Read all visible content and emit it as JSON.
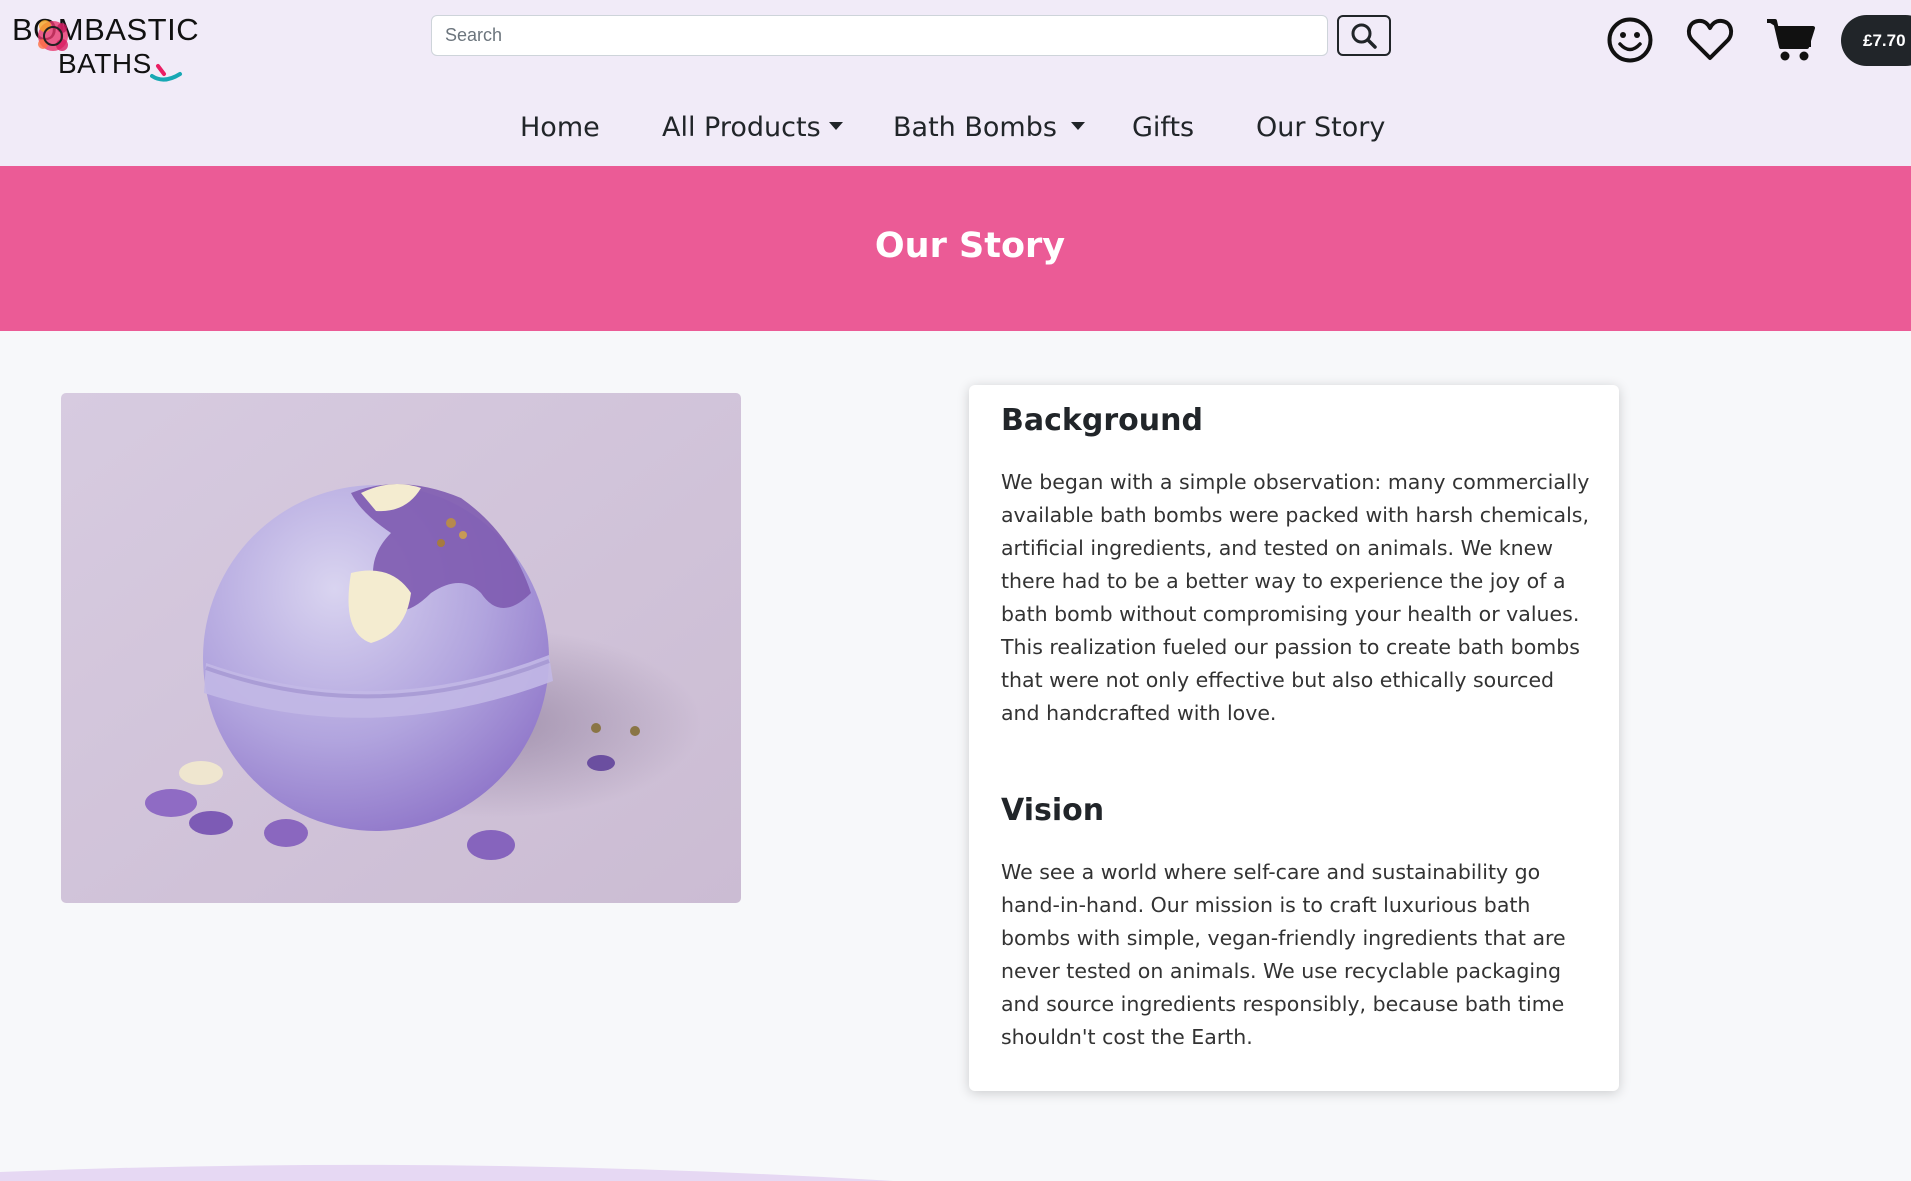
{
  "brand": {
    "line1": "BOMBASTIC",
    "line2": "BATHS"
  },
  "search": {
    "placeholder": "Search",
    "value": ""
  },
  "header_icons": [
    "smile-icon",
    "heart-icon",
    "cart-icon"
  ],
  "cart": {
    "total": "£7.70"
  },
  "nav": {
    "home": "Home",
    "all_products": "All Products",
    "bath_bombs": "Bath Bombs",
    "gifts": "Gifts",
    "our_story": "Our Story"
  },
  "banner": {
    "title": "Our Story"
  },
  "sections": {
    "background": {
      "heading": "Background",
      "body": "We began with a simple observation: many commercially available bath bombs were packed with harsh chemicals, artificial ingredients, and tested on animals. We knew there had to be a better way to experience the joy of a bath bomb without compromising your health or values. This realization fueled our passion to create bath bombs that were not only effective but also ethically sourced and handcrafted with love."
    },
    "vision": {
      "heading": "Vision",
      "body": "We see a world where self-care and sustainability go hand-in-hand. Our mission is to craft luxurious bath bombs with simple, vegan-friendly ingredients that are never tested on animals. We use recyclable packaging and source ingredients responsibly, because bath time shouldn't cost the Earth."
    }
  },
  "colors": {
    "header_bg": "#f1ebf8",
    "banner_bg": "#eb5b96",
    "page_bg": "#f7f8fa",
    "dark": "#212529"
  }
}
